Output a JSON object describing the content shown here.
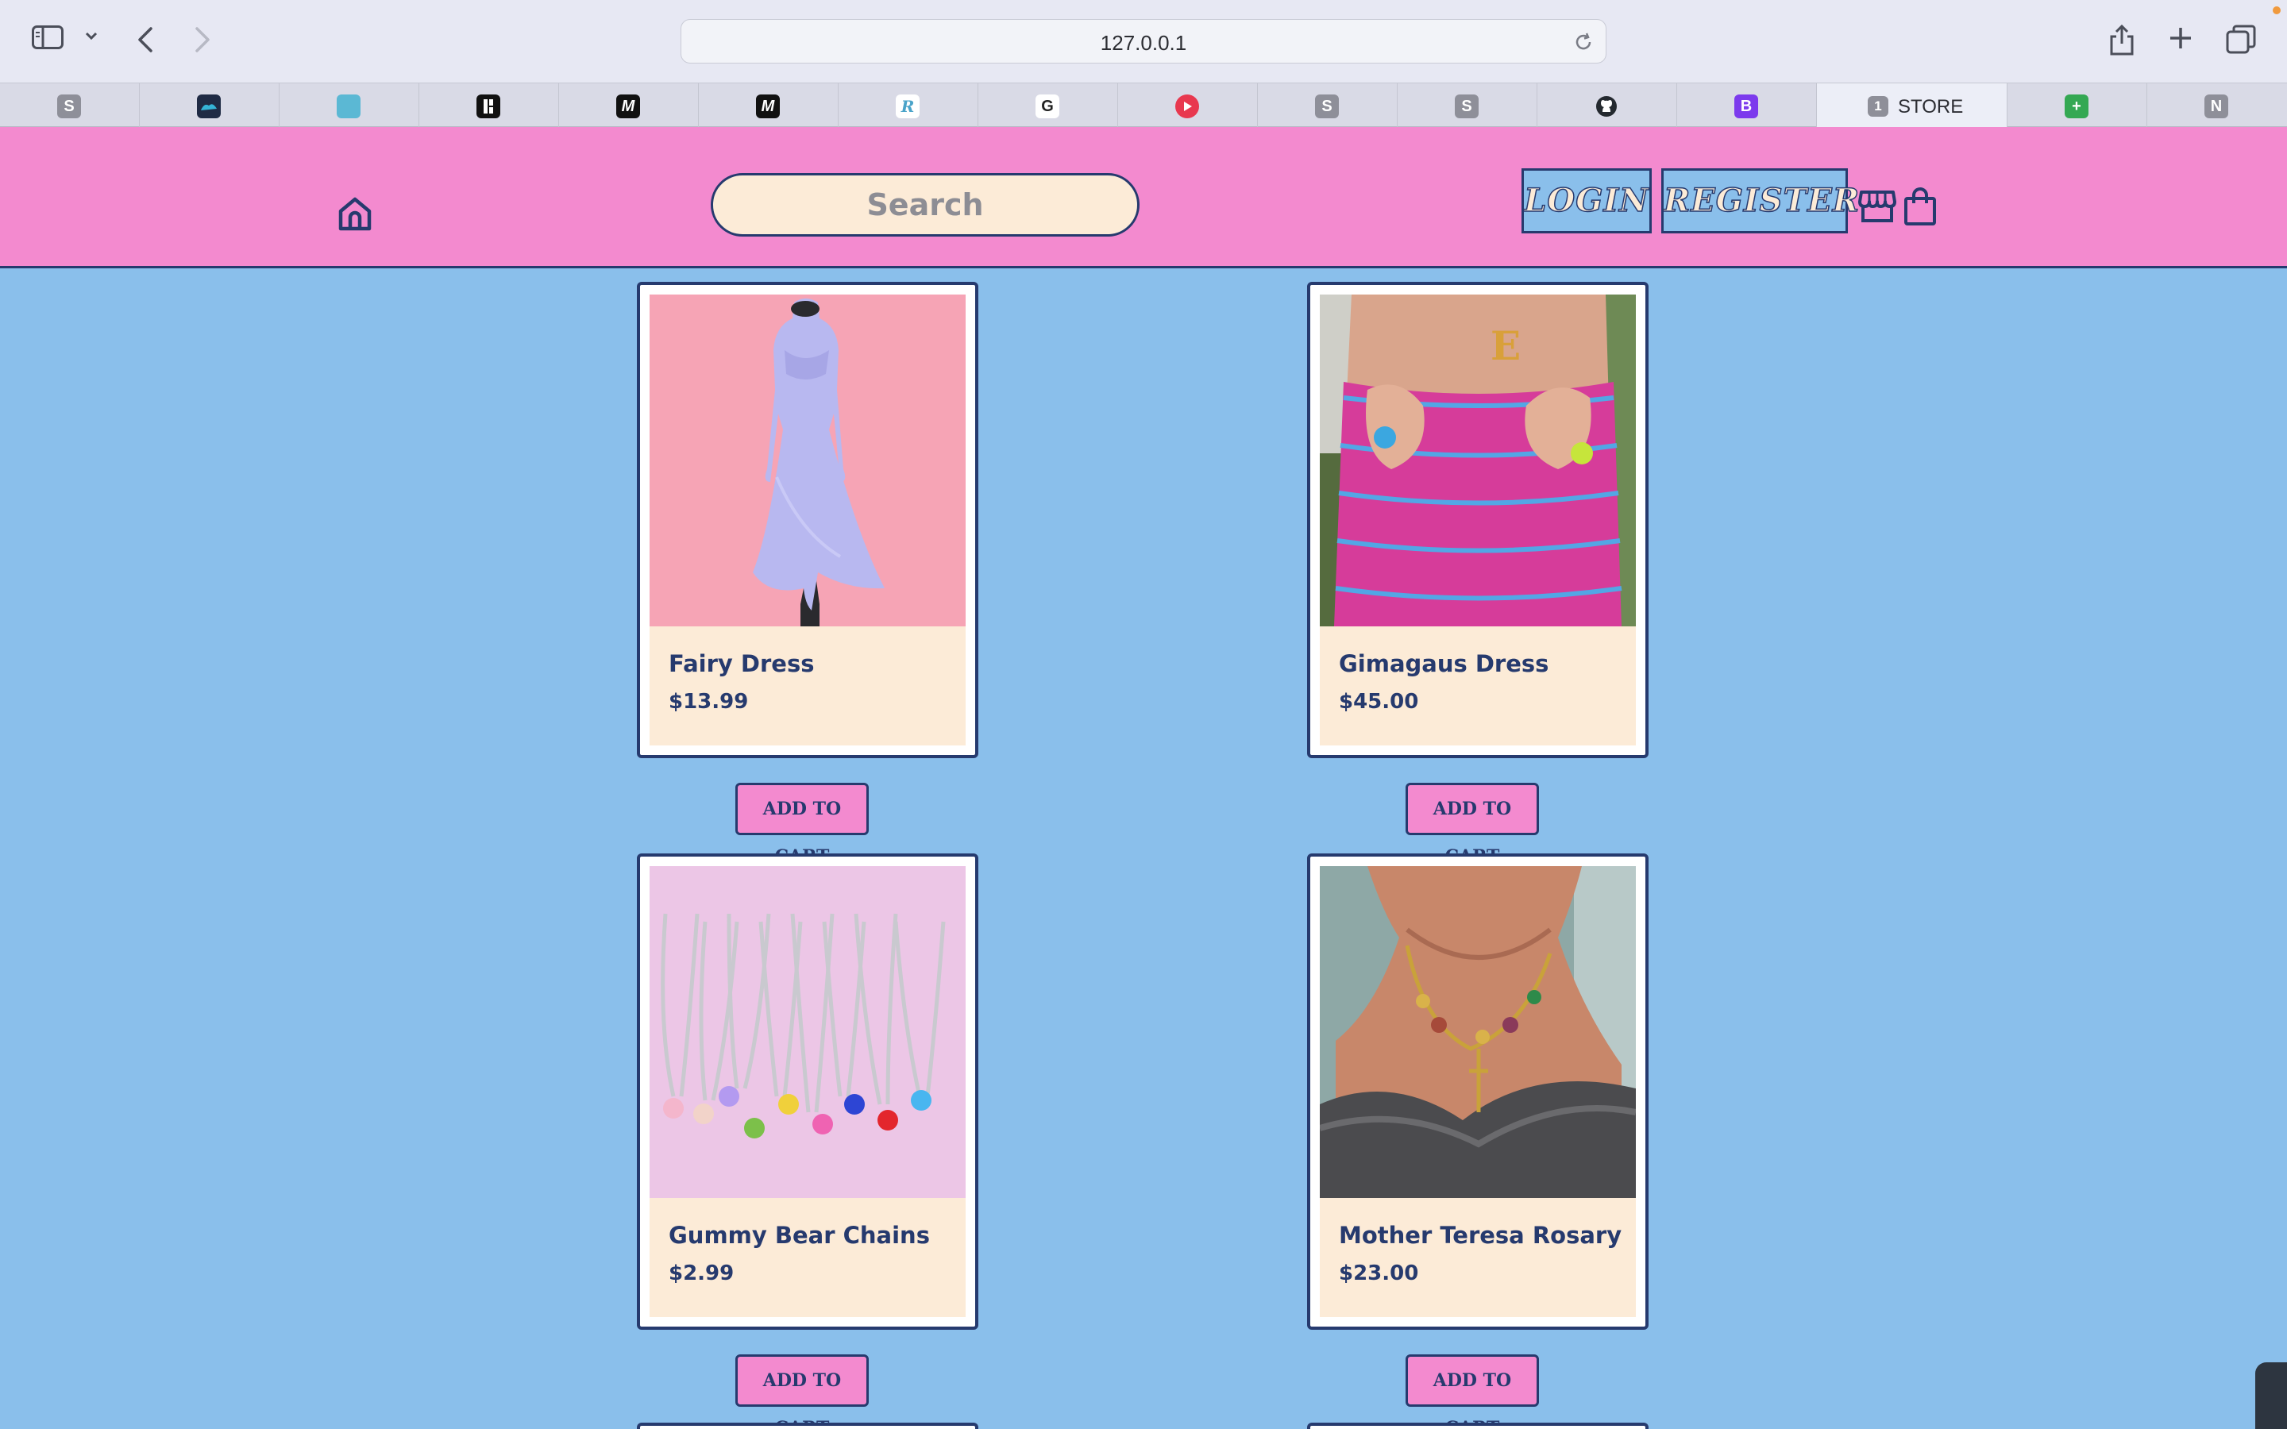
{
  "browser": {
    "address": "127.0.0.1",
    "tabs": [
      {
        "icon_text": "S",
        "icon_color": "#8e8f99",
        "label": ""
      },
      {
        "icon_text": "",
        "icon_color": "#1f2a44",
        "label": ""
      },
      {
        "icon_text": "",
        "icon_color": "#5bb8d4",
        "label": ""
      },
      {
        "icon_text": "",
        "icon_color": "#111111",
        "label": ""
      },
      {
        "icon_text": "M",
        "icon_color": "#111111",
        "label": ""
      },
      {
        "icon_text": "M",
        "icon_color": "#111111",
        "label": ""
      },
      {
        "icon_text": "R",
        "icon_color": "#ffffff",
        "label": ""
      },
      {
        "icon_text": "G",
        "icon_color": "#ffffff",
        "label": ""
      },
      {
        "icon_text": "",
        "icon_color": "#e8384f",
        "label": ""
      },
      {
        "icon_text": "S",
        "icon_color": "#8e8f99",
        "label": ""
      },
      {
        "icon_text": "S",
        "icon_color": "#8e8f99",
        "label": ""
      },
      {
        "icon_text": "",
        "icon_color": "#24292f",
        "label": ""
      },
      {
        "icon_text": "B",
        "icon_color": "#7c3aed",
        "label": ""
      },
      {
        "icon_text": "1",
        "icon_color": "#8e8f99",
        "label": "STORE"
      },
      {
        "icon_text": "+",
        "icon_color": "#34a853",
        "label": ""
      },
      {
        "icon_text": "N",
        "icon_color": "#8e8f99",
        "label": ""
      }
    ]
  },
  "header": {
    "search_placeholder": "Search",
    "login_label": "LOGIN",
    "register_label": "REGISTER",
    "accent_color": "#f38acf",
    "primary_color": "#263a6e"
  },
  "products": [
    {
      "name": "Fairy Dress",
      "price": "$13.99",
      "add_label": "ADD TO CART"
    },
    {
      "name": "Gimagaus Dress",
      "price": "$45.00",
      "add_label": "ADD TO CART"
    },
    {
      "name": "Gummy Bear Chains",
      "price": "$2.99",
      "add_label": "ADD TO CART"
    },
    {
      "name": "Mother Teresa Rosary",
      "price": "$23.00",
      "add_label": "ADD TO CART"
    }
  ]
}
